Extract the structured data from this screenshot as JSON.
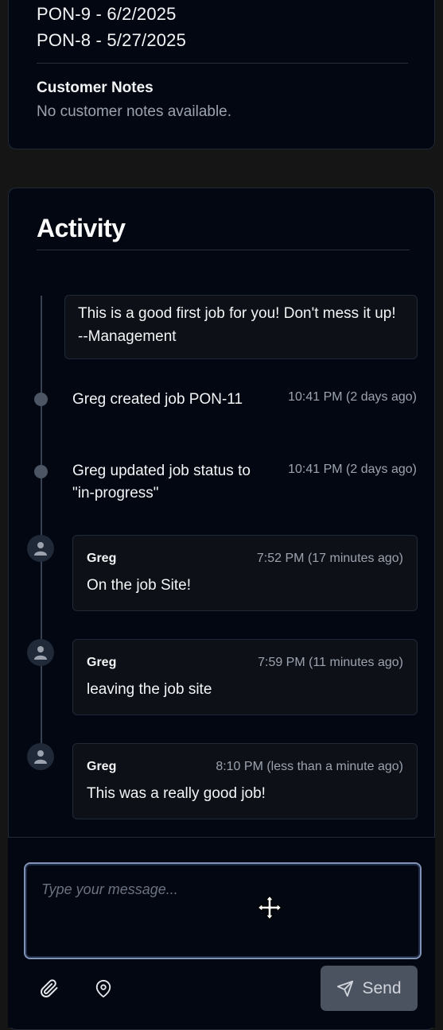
{
  "job_details": {
    "pon_entries": [
      "PON-9 - 6/2/2025",
      "PON-8 - 5/27/2025"
    ],
    "customer_notes_label": "Customer Notes",
    "customer_notes_value": "No customer notes available."
  },
  "activity": {
    "title": "Activity",
    "pinned_note": "This is a good first job for you! Don't mess it up! --Management",
    "events": [
      {
        "text": "Greg created job PON-11",
        "time": "10:41 PM (2 days ago)"
      },
      {
        "text": "Greg updated job status to \"in-progress\"",
        "time": "10:41 PM (2 days ago)"
      }
    ],
    "messages": [
      {
        "author": "Greg",
        "time": "7:52 PM (17 minutes ago)",
        "text": "On the job Site!"
      },
      {
        "author": "Greg",
        "time": "7:59 PM (11 minutes ago)",
        "text": "leaving the job site"
      },
      {
        "author": "Greg",
        "time": "8:10 PM (less than a minute ago)",
        "text": "This was a really good job!"
      }
    ]
  },
  "composer": {
    "placeholder": "Type your message...",
    "send_label": "Send",
    "attach_icon": "paperclip-icon",
    "location_icon": "map-pin-icon",
    "send_icon": "send-icon"
  },
  "colors": {
    "background": "#151515",
    "card": "#030712",
    "border": "#1f2937",
    "muted_text": "#9ca3af",
    "input_focus_border": "#8193b8",
    "send_button": "#4b5260"
  }
}
